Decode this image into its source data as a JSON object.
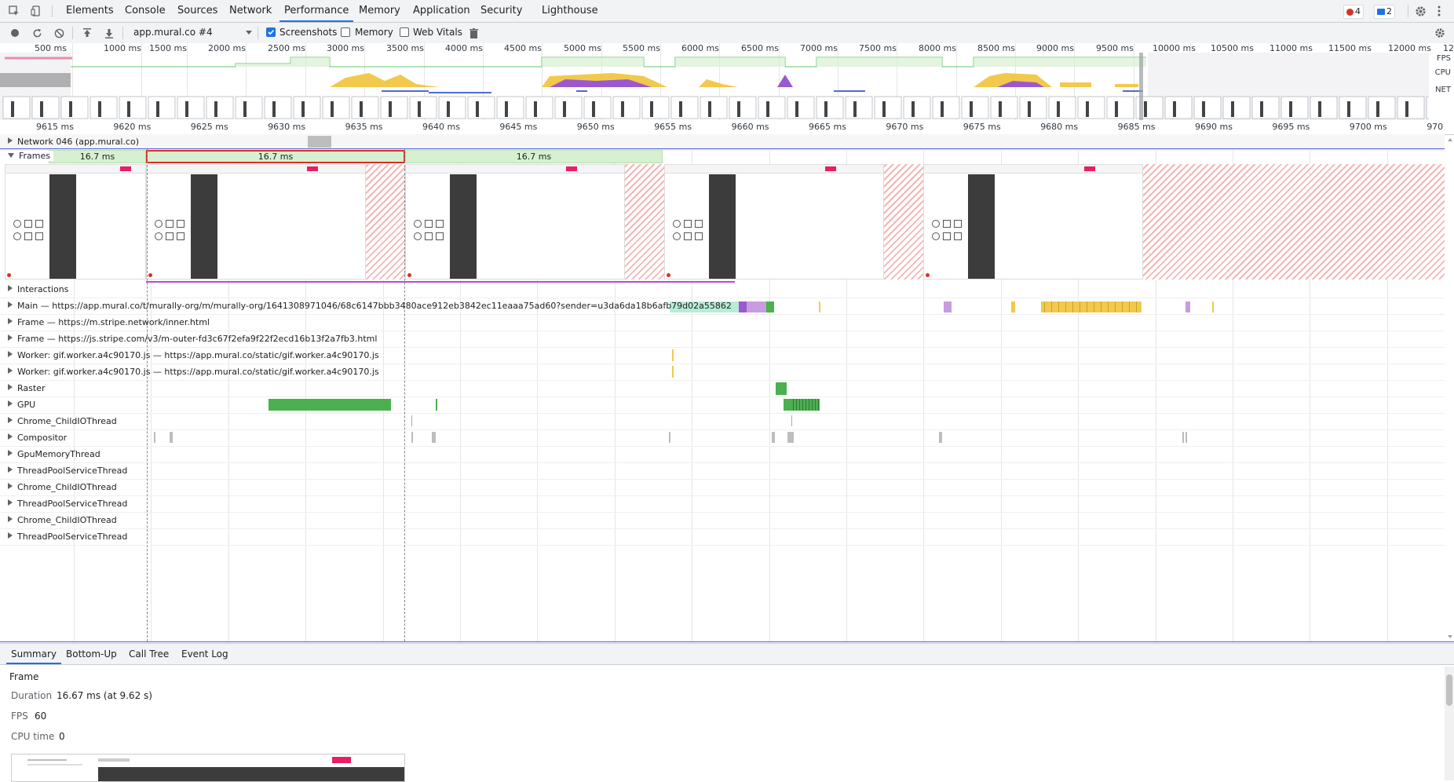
{
  "tabs": [
    "Elements",
    "Console",
    "Sources",
    "Network",
    "Performance",
    "Memory",
    "Application",
    "Security",
    "Lighthouse"
  ],
  "active_tab": "Performance",
  "badges": {
    "errors": "4",
    "messages": "2"
  },
  "toolbar": {
    "recording": "app.mural.co #4",
    "screenshots_label": "Screenshots",
    "memory_label": "Memory",
    "webvitals_label": "Web Vitals"
  },
  "overview": {
    "labels": [
      "500 ms",
      "1000 ms",
      "1500 ms",
      "2000 ms",
      "2500 ms",
      "3000 ms",
      "3500 ms",
      "4000 ms",
      "4500 ms",
      "5000 ms",
      "5500 ms",
      "6000 ms",
      "6500 ms",
      "7000 ms",
      "7500 ms",
      "8000 ms",
      "8500 ms",
      "9000 ms",
      "9500 ms",
      "10000 ms",
      "10500 ms",
      "11000 ms",
      "11500 ms",
      "12000 ms",
      "12"
    ],
    "side": {
      "fps": "FPS",
      "cpu": "CPU",
      "net": "NET"
    }
  },
  "ruler": [
    "9615 ms",
    "9620 ms",
    "9625 ms",
    "9630 ms",
    "9635 ms",
    "9640 ms",
    "9645 ms",
    "9650 ms",
    "9655 ms",
    "9660 ms",
    "9665 ms",
    "9670 ms",
    "9675 ms",
    "9680 ms",
    "9685 ms",
    "9690 ms",
    "9695 ms",
    "9700 ms",
    "970"
  ],
  "tracks": {
    "network": "Network 046 (app.mural.co)",
    "frames": "Frames",
    "frame_durations": [
      "16.7 ms",
      "16.7 ms",
      "16.7 ms"
    ],
    "rows": [
      "Interactions",
      "Main — https://app.mural.co/t/murally-org/m/murally-org/1641308971046/68c6147bbb3480ace912eb3842ec11eaaa75ad60?sender=u3da6da18b6afb79d02a55862",
      "Frame — https://m.stripe.network/inner.html",
      "Frame — https://js.stripe.com/v3/m-outer-fd3c67f2efa9f22f2ecd16b13f2a7fb3.html",
      "Worker: gif.worker.a4c90170.js — https://app.mural.co/static/gif.worker.a4c90170.js",
      "Worker: gif.worker.a4c90170.js — https://app.mural.co/static/gif.worker.a4c90170.js",
      "Raster",
      "GPU",
      "Chrome_ChildIOThread",
      "Compositor",
      "GpuMemoryThread",
      "ThreadPoolServiceThread",
      "Chrome_ChildIOThread",
      "ThreadPoolServiceThread",
      "Chrome_ChildIOThread",
      "ThreadPoolServiceThread"
    ]
  },
  "bottom_tabs": [
    "Summary",
    "Bottom-Up",
    "Call Tree",
    "Event Log"
  ],
  "summary": {
    "title": "Frame",
    "duration_key": "Duration",
    "duration_val": "16.67 ms (at 9.62 s)",
    "fps_key": "FPS",
    "fps_val": "60",
    "cpu_key": "CPU time",
    "cpu_val": "0"
  },
  "colors": {
    "accent": "#1a73e8",
    "fps": "#d7f0d1",
    "cpu_scripting": "#f2c94c",
    "cpu_rendering": "#9b59d0",
    "gpu": "#4caf50",
    "selection": "#d93025"
  }
}
